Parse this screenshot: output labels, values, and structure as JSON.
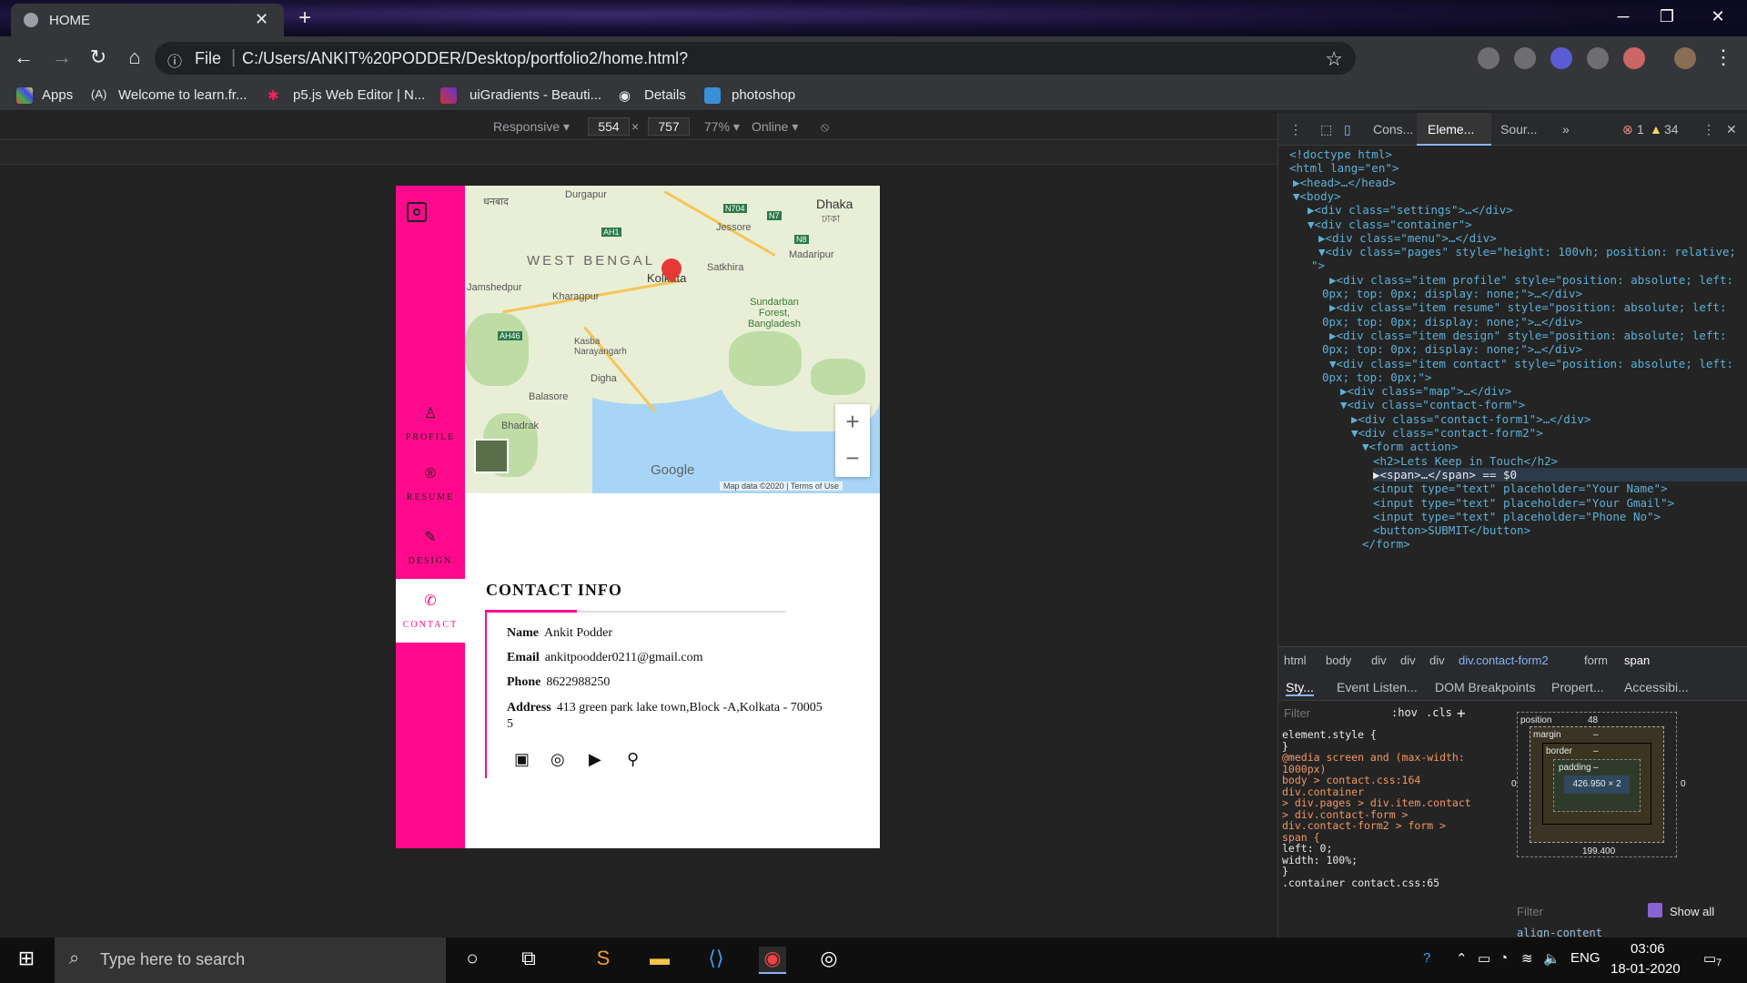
{
  "browser": {
    "tab_title": "HOME",
    "url": "C:/Users/ANKIT%20PODDER/Desktop/portfolio2/home.html?",
    "file_label": "File",
    "bookmarks": [
      "Apps",
      "Welcome to learn.fr...",
      "p5.js Web Editor | N...",
      "uiGradients - Beauti...",
      "Details",
      "photoshop"
    ]
  },
  "device_toolbar": {
    "mode": "Responsive ▾",
    "width": "554",
    "times": "×",
    "height": "757",
    "zoom": "77% ▾",
    "network": "Online ▾"
  },
  "site": {
    "nav": [
      {
        "label": "PROFILE",
        "icon": "user-icon"
      },
      {
        "label": "RESUME",
        "icon": "registered-icon"
      },
      {
        "label": "DESIGN",
        "icon": "edit-icon"
      },
      {
        "label": "CONTACT",
        "icon": "phone-icon"
      }
    ],
    "map": {
      "labels": {
        "dhaka": "Dhaka",
        "dhaka_bn": "ঢাকা",
        "durgapur": "Durgapur",
        "jessore": "Jessore",
        "madaripur": "Madaripur",
        "west_bengal": "WEST BENGAL",
        "kolkata": "Kolkata",
        "satkhira": "Satkhira",
        "jamshedpur": "Jamshedpur",
        "kharagpur": "Kharagpur",
        "sundarban": "Sundarban Forest, Bangladesh",
        "kasba": "Kasba Narayangarh",
        "digha": "Digha",
        "balasore": "Balasore",
        "bhadrak": "Bhadrak",
        "dhanbad": "धनबाद"
      },
      "roads": {
        "n704": "N704",
        "n7": "N7",
        "n8": "N8",
        "ah1": "AH1",
        "ah46": "AH46"
      },
      "google": "Google",
      "attribution": "Map data ©2020 | Terms of Use",
      "zoom_in": "+",
      "zoom_out": "−"
    },
    "contact": {
      "heading": "CONTACT  INFO",
      "name_label": "Name",
      "name": "Ankit Podder",
      "email_label": "Email",
      "email": "ankitpoodder0211@gmail.com",
      "phone_label": "Phone",
      "phone": "8622988250",
      "address_label": "Address",
      "address": "413 green park lake town,Block -A,Kolkata - 70005",
      "address_cont": "5",
      "socials": [
        "facebook-icon",
        "instagram-icon",
        "youtube-icon",
        "map-icon"
      ]
    }
  },
  "devtools": {
    "tabs": [
      "Cons...",
      "Eleme...",
      "Sour...",
      "»"
    ],
    "errors": "1",
    "warnings": "34",
    "dom_lines": [
      "<!doctype html>",
      "<html lang=\"en\">",
      "▶<head>…</head>",
      "▼<body>",
      "▶<div class=\"settings\">…</div>",
      "▼<div class=\"container\">",
      "▶<div class=\"menu\">…</div>",
      "▼<div class=\"pages\" style=\"height: 100vh; position: relative;",
      "\">",
      "▶<div class=\"item profile\" style=\"position: absolute; left:",
      "0px; top: 0px; display: none;\">…</div>",
      "▶<div class=\"item resume\" style=\"position: absolute; left:",
      "0px; top: 0px; display: none;\">…</div>",
      "▶<div class=\"item design\" style=\"position: absolute; left:",
      "0px; top: 0px; display: none;\">…</div>",
      "▼<div class=\"item contact\" style=\"position: absolute; left:",
      "0px; top: 0px;\">",
      "▶<div class=\"map\">…</div>",
      "▼<div class=\"contact-form\">",
      "▶<div class=\"contact-form1\">…</div>",
      "▼<div class=\"contact-form2\">",
      "▼<form action>",
      "<h2>Lets Keep in Touch</h2>",
      "▶<span>…</span> == $0",
      "<input type=\"text\" placeholder=\"Your Name\">",
      "<input type=\"text\" placeholder=\"Your Gmail\">",
      "<input type=\"text\" placeholder=\"Phone No\">",
      "<button>SUBMIT</button>",
      "</form>"
    ],
    "breadcrumbs": [
      "html",
      "body",
      "div",
      "div",
      "div",
      "div.contact-form2",
      "form",
      "span"
    ],
    "subtabs": [
      "Sty...",
      "Event Listen...",
      "DOM Breakpoints",
      "Propert...",
      "Accessibi..."
    ],
    "filter_placeholder": "Filter",
    "hov": ":hov",
    "cls": ".cls",
    "styles_lines": [
      "element.style {",
      "}",
      "@media screen and (max-width:",
      "1000px)",
      "body >            contact.css:164",
      "div.container",
      "> div.pages > div.item.contact",
      "> div.contact-form >",
      "div.contact-form2 > form >",
      "span {",
      "  left: 0;",
      "  width: 100%;",
      "}",
      ".container         contact.css:65"
    ],
    "box_model": {
      "position": "position",
      "position_val": "48",
      "margin": "margin",
      "border": "border",
      "padding": "padding",
      "content": "426.950 × 2",
      "dash": "–",
      "zero": "0",
      "bottom": "199.400"
    },
    "filter2": "Filter",
    "show_all": "Show all",
    "align": "align-content"
  },
  "taskbar": {
    "search": "Type here to search",
    "lang": "ENG",
    "time": "03:06",
    "date": "18-01-2020",
    "notif": "7"
  }
}
